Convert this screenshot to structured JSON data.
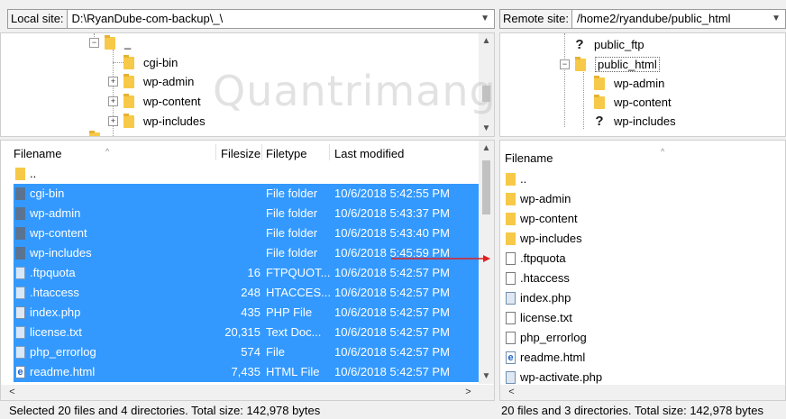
{
  "local": {
    "site_label": "Local site:",
    "site_path": "D:\\RyanDube-com-backup\\_\\",
    "tree": [
      {
        "label": "_",
        "expander": "−"
      },
      {
        "label": "cgi-bin",
        "expander": ""
      },
      {
        "label": "wp-admin",
        "expander": "+"
      },
      {
        "label": "wp-content",
        "expander": "+"
      },
      {
        "label": "wp-includes",
        "expander": "+"
      }
    ],
    "columns": {
      "filename": "Filename",
      "filesize": "Filesize",
      "filetype": "Filetype",
      "modified": "Last modified"
    },
    "files": [
      {
        "name": "..",
        "size": "",
        "type": "",
        "modified": "",
        "kind": "folder",
        "selected": false
      },
      {
        "name": "cgi-bin",
        "size": "",
        "type": "File folder",
        "modified": "10/6/2018 5:42:55 PM",
        "kind": "dir",
        "selected": true
      },
      {
        "name": "wp-admin",
        "size": "",
        "type": "File folder",
        "modified": "10/6/2018 5:43:37 PM",
        "kind": "dir",
        "selected": true
      },
      {
        "name": "wp-content",
        "size": "",
        "type": "File folder",
        "modified": "10/6/2018 5:43:40 PM",
        "kind": "dir",
        "selected": true
      },
      {
        "name": "wp-includes",
        "size": "",
        "type": "File folder",
        "modified": "10/6/2018 5:45:59 PM",
        "kind": "dir",
        "selected": true
      },
      {
        "name": ".ftpquota",
        "size": "16",
        "type": "FTPQUOT...",
        "modified": "10/6/2018 5:42:57 PM",
        "kind": "doc",
        "selected": true
      },
      {
        "name": ".htaccess",
        "size": "248",
        "type": "HTACCES...",
        "modified": "10/6/2018 5:42:57 PM",
        "kind": "doc",
        "selected": true
      },
      {
        "name": "index.php",
        "size": "435",
        "type": "PHP File",
        "modified": "10/6/2018 5:42:57 PM",
        "kind": "php",
        "selected": true
      },
      {
        "name": "license.txt",
        "size": "20,315",
        "type": "Text Doc...",
        "modified": "10/6/2018 5:42:57 PM",
        "kind": "doc",
        "selected": true
      },
      {
        "name": "php_errorlog",
        "size": "574",
        "type": "File",
        "modified": "10/6/2018 5:42:57 PM",
        "kind": "doc",
        "selected": true
      },
      {
        "name": "readme.html",
        "size": "7,435",
        "type": "HTML File",
        "modified": "10/6/2018 5:42:57 PM",
        "kind": "html",
        "selected": true
      }
    ],
    "status": "Selected 20 files and 4 directories. Total size: 142,978 bytes"
  },
  "remote": {
    "site_label": "Remote site:",
    "site_path": "/home2/ryandube/public_html",
    "tree": [
      {
        "label": "public_ftp",
        "icon": "question"
      },
      {
        "label": "public_html",
        "icon": "folder",
        "expander": "−"
      },
      {
        "label": "wp-admin",
        "icon": "folder"
      },
      {
        "label": "wp-content",
        "icon": "folder"
      },
      {
        "label": "wp-includes",
        "icon": "question"
      }
    ],
    "columns": {
      "filename": "Filename"
    },
    "files": [
      {
        "name": "..",
        "kind": "folder"
      },
      {
        "name": "wp-admin",
        "kind": "folder"
      },
      {
        "name": "wp-content",
        "kind": "folder"
      },
      {
        "name": "wp-includes",
        "kind": "folder"
      },
      {
        "name": ".ftpquota",
        "kind": "doc"
      },
      {
        "name": ".htaccess",
        "kind": "doc"
      },
      {
        "name": "index.php",
        "kind": "php"
      },
      {
        "name": "license.txt",
        "kind": "doc"
      },
      {
        "name": "php_errorlog",
        "kind": "doc"
      },
      {
        "name": "readme.html",
        "kind": "html"
      },
      {
        "name": "wp-activate.php",
        "kind": "php"
      }
    ],
    "status": "20 files and 3 directories. Total size: 142,978 bytes"
  },
  "watermark": "Quantrimang",
  "colors": {
    "selection": "#3399ff",
    "arrow": "#e02020",
    "folder": "#f7c948"
  }
}
